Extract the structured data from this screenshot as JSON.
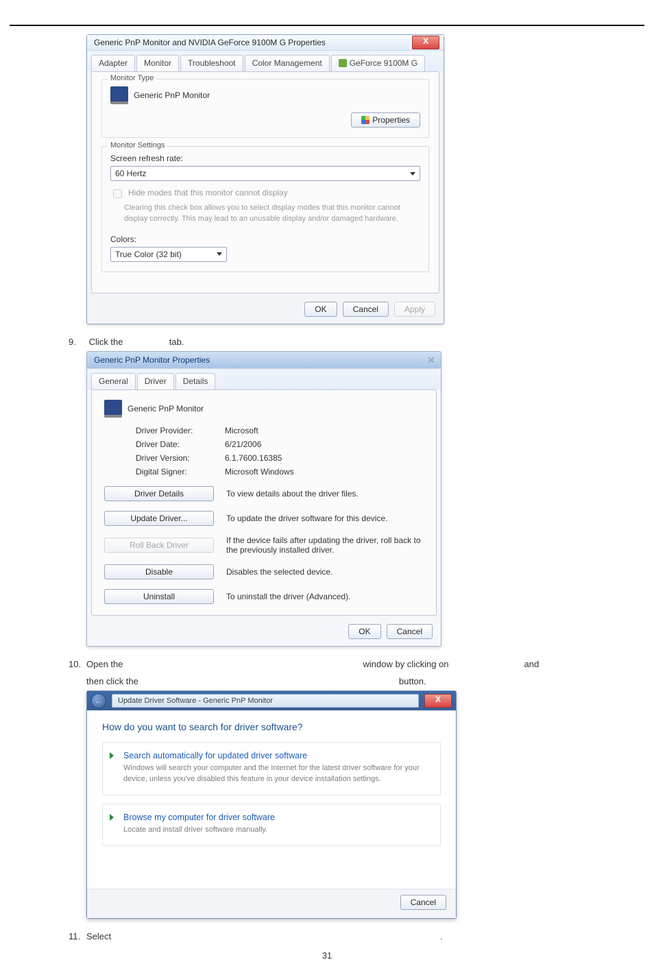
{
  "page_number": "31",
  "steps": {
    "s9": {
      "num": "9.",
      "text_before": "Click the",
      "text_after": "tab."
    },
    "s10": {
      "num": "10.",
      "text_before": "Open the",
      "text_mid": "window by clicking on",
      "text_and": "and",
      "line2_before": "then click the",
      "line2_after": "button."
    },
    "s11": {
      "num": "11.",
      "text_before": "Select",
      "text_after": "."
    }
  },
  "dlg1": {
    "title": "Generic PnP Monitor and NVIDIA GeForce 9100M G   Properties",
    "close": "X",
    "tabs": [
      "Adapter",
      "Monitor",
      "Troubleshoot",
      "Color Management",
      "GeForce 9100M G"
    ],
    "active_tab_index": 1,
    "monitor_type_group": "Monitor Type",
    "monitor_name": "Generic PnP Monitor",
    "properties_btn": "Properties",
    "monitor_settings_group": "Monitor Settings",
    "refresh_label": "Screen refresh rate:",
    "refresh_value": "60 Hertz",
    "hide_modes": "Hide modes that this monitor cannot display",
    "hide_help": "Clearing this check box allows you to select display modes that this monitor cannot display correctly. This may lead to an unusable display and/or damaged hardware.",
    "colors_label": "Colors:",
    "colors_value": "True Color (32 bit)",
    "ok": "OK",
    "cancel": "Cancel",
    "apply": "Apply"
  },
  "dlg2": {
    "title": "Generic PnP Monitor Properties",
    "close": "✕",
    "tabs": [
      "General",
      "Driver",
      "Details"
    ],
    "active_tab_index": 1,
    "device_name": "Generic PnP Monitor",
    "rows": [
      {
        "label": "Driver Provider:",
        "value": "Microsoft"
      },
      {
        "label": "Driver Date:",
        "value": "6/21/2006"
      },
      {
        "label": "Driver Version:",
        "value": "6.1.7600.16385"
      },
      {
        "label": "Digital Signer:",
        "value": "Microsoft Windows"
      }
    ],
    "buttons": [
      {
        "label": "Driver Details",
        "desc": "To view details about the driver files.",
        "disabled": false
      },
      {
        "label": "Update Driver...",
        "desc": "To update the driver software for this device.",
        "disabled": false
      },
      {
        "label": "Roll Back Driver",
        "desc": "If the device fails after updating the driver, roll back to the previously installed driver.",
        "disabled": true
      },
      {
        "label": "Disable",
        "desc": "Disables the selected device.",
        "disabled": false
      },
      {
        "label": "Uninstall",
        "desc": "To uninstall the driver (Advanced).",
        "disabled": false
      }
    ],
    "ok": "OK",
    "cancel": "Cancel"
  },
  "dlg3": {
    "close": "X",
    "path": "Update Driver Software - Generic PnP Monitor",
    "heading": "How do you want to search for driver software?",
    "options": [
      {
        "title": "Search automatically for updated driver software",
        "desc": "Windows will search your computer and the Internet for the latest driver software for your device, unless you've disabled this feature in your device installation settings."
      },
      {
        "title": "Browse my computer for driver software",
        "desc": "Locate and install driver software manually."
      }
    ],
    "cancel": "Cancel"
  }
}
